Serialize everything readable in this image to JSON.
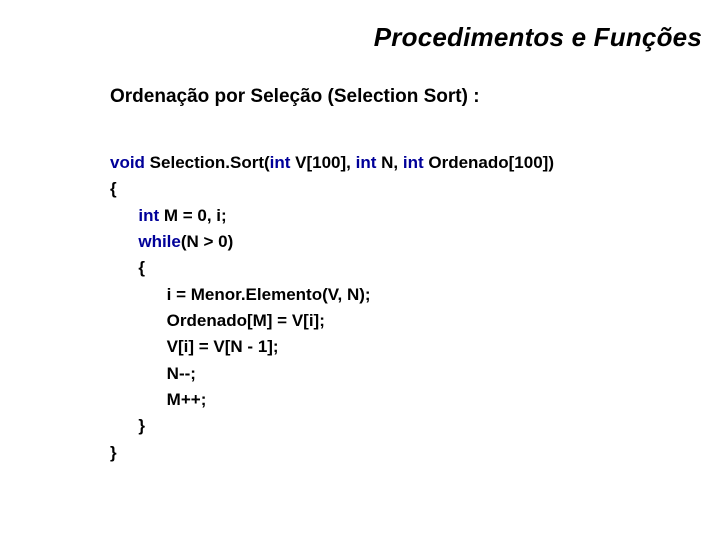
{
  "title": "Procedimentos e Funções",
  "subtitle": "Ordenação por Seleção (Selection Sort) :",
  "code": {
    "l1": {
      "kw_void": "void",
      "fn": " Selection.Sort(",
      "kw_int1": "int",
      "p1": " V[100], ",
      "kw_int2": "int",
      "p2": " N, ",
      "kw_int3": "int",
      "p3": " Ordenado[100])"
    },
    "l2": "{",
    "l3": {
      "indent": "      ",
      "kw_int": "int",
      "rest": " M = 0, i;"
    },
    "l4": {
      "indent": "      ",
      "kw_while": "while",
      "rest": "(N > 0)"
    },
    "l5": "      {",
    "l6": "            i = Menor.Elemento(V, N);",
    "l7": "            Ordenado[M] = V[i];",
    "l8": "            V[i] = V[N - 1];",
    "l9": "            N--;",
    "l10": "            M++;",
    "l11": "      }",
    "l12": "}"
  }
}
